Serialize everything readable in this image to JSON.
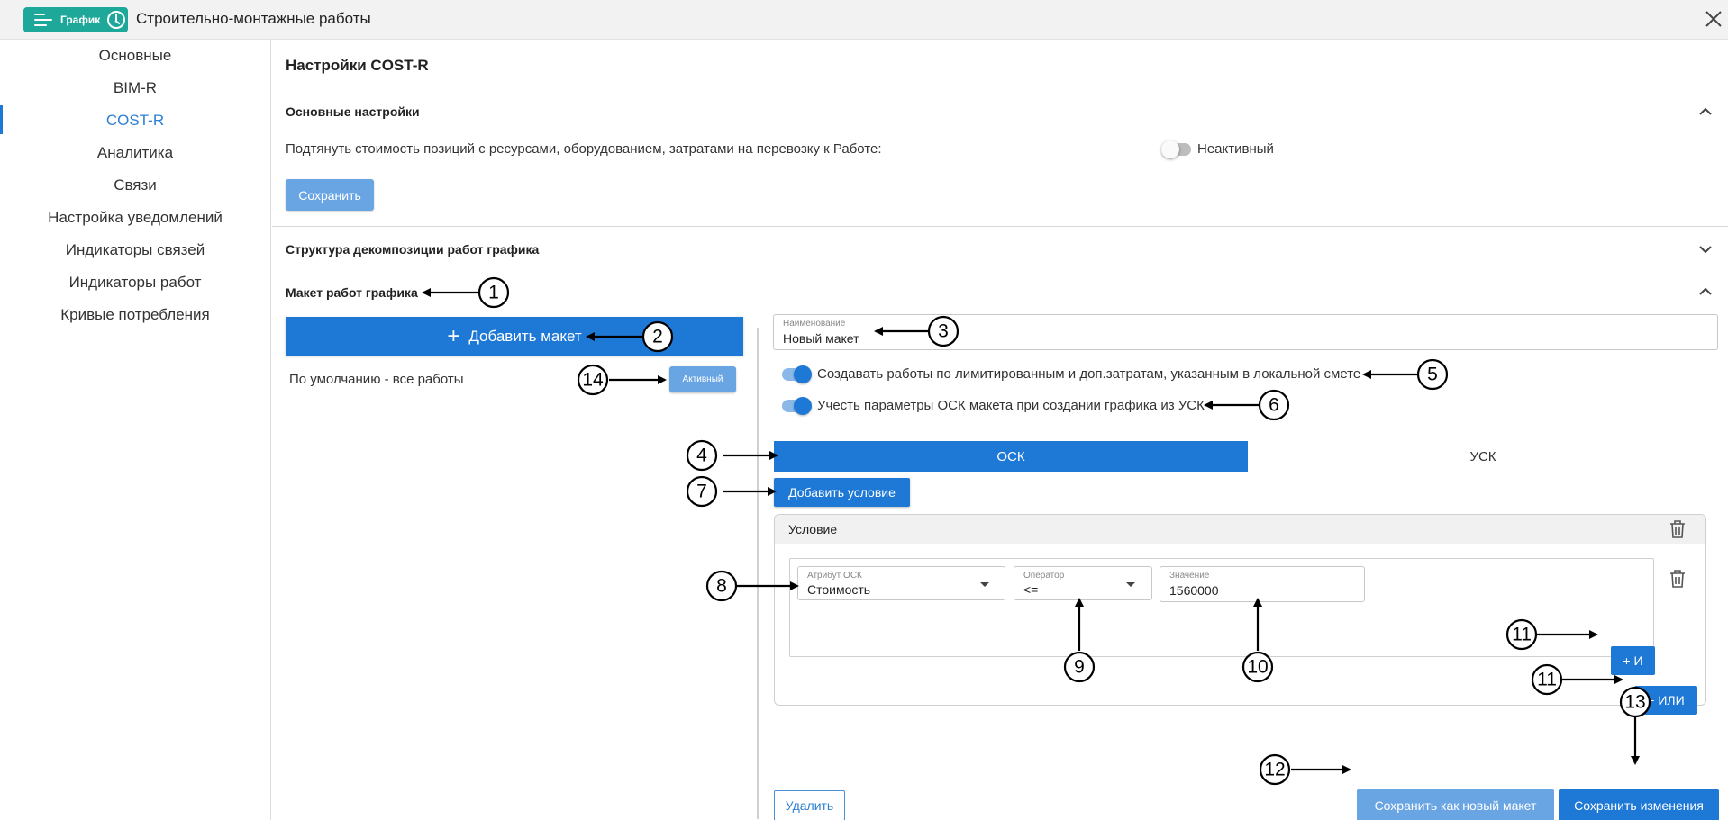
{
  "header": {
    "badge_label": "График",
    "title": "Строительно-монтажные работы"
  },
  "sidebar": {
    "items": [
      {
        "label": "Основные"
      },
      {
        "label": "BIM-R"
      },
      {
        "label": "COST-R",
        "active": true
      },
      {
        "label": "Аналитика"
      },
      {
        "label": "Связи"
      },
      {
        "label": "Настройка уведомлений"
      },
      {
        "label": "Индикаторы связей"
      },
      {
        "label": "Индикаторы работ"
      },
      {
        "label": "Кривые потребления"
      }
    ]
  },
  "main": {
    "page_title": "Настройки COST-R",
    "basic": {
      "title": "Основные настройки",
      "setting_label": "Подтянуть стоимость позиций с ресурсами, оборудованием, затратами на перевозку к Работе:",
      "toggle_status": "Неактивный",
      "save_label": "Сохранить"
    },
    "wbs_title": "Структура декомпозиции работ графика",
    "layout": {
      "title": "Макет работ графика",
      "add_label": "Добавить макет",
      "default_item": "По умолчанию - все работы",
      "active_badge": "Активный",
      "name_label": "Наименование",
      "name_value": "Новый макет",
      "option1": "Создавать работы по лимитированным и доп.затратам, указанным в локальной смете",
      "option2": "Учесть параметры ОСК макета при создании графика из УСК",
      "tabs": [
        "ОСК",
        "УСК"
      ],
      "add_condition": "Добавить условие",
      "condition": {
        "title": "Условие",
        "attr_label": "Атрибут ОСК",
        "attr_value": "Стоимость",
        "op_label": "Оператор",
        "op_value": "<=",
        "val_label": "Значение",
        "val_value": "1560000",
        "and_label": "+ И",
        "or_label": "+ ИЛИ"
      },
      "delete_label": "Удалить",
      "save_new_label": "Сохранить как новый макет",
      "save_changes_label": "Сохранить изменения"
    }
  },
  "annotations": [
    "1",
    "2",
    "3",
    "4",
    "5",
    "6",
    "7",
    "8",
    "9",
    "10",
    "11",
    "11",
    "12",
    "13",
    "14"
  ],
  "colors": {
    "accent": "#1e78d6",
    "accent_light": "#6aa5e3",
    "teal": "#1ea89a"
  }
}
